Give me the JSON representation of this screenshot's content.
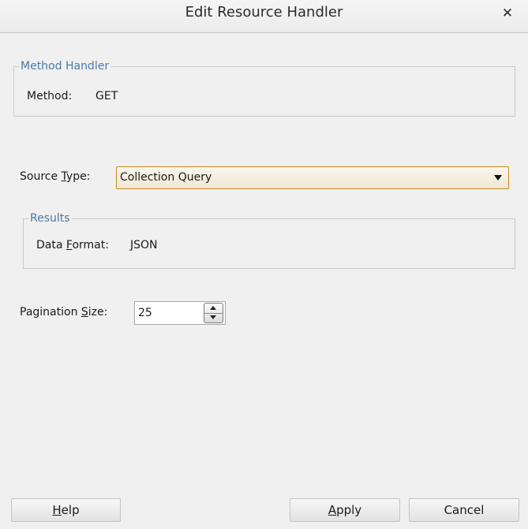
{
  "dialog": {
    "title": "Edit Resource Handler"
  },
  "method_group": {
    "legend": "Method Handler",
    "method_label": "Method:",
    "method_value": "GET"
  },
  "source": {
    "label_pre": "Source ",
    "label_mnemonic": "T",
    "label_post": "ype:",
    "selected": "Collection Query"
  },
  "results_group": {
    "legend": "Results",
    "format_label_pre": "Data ",
    "format_label_mnemonic": "F",
    "format_label_post": "ormat:",
    "format_value": "JSON"
  },
  "pagination": {
    "label_pre": "Pagination ",
    "label_mnemonic": "S",
    "label_post": "ize:",
    "value": "25"
  },
  "buttons": {
    "help_mnemonic": "H",
    "help_rest": "elp",
    "apply_mnemonic": "A",
    "apply_rest": "pply",
    "cancel": "Cancel"
  },
  "colors": {
    "legend_text": "#4a7aa8",
    "select_border": "#c88a1e",
    "background": "#f0f0f0"
  },
  "icons": {
    "close": "close-icon",
    "dropdown": "chevron-down-icon",
    "spin_up": "spin-up-icon",
    "spin_down": "spin-down-icon"
  }
}
